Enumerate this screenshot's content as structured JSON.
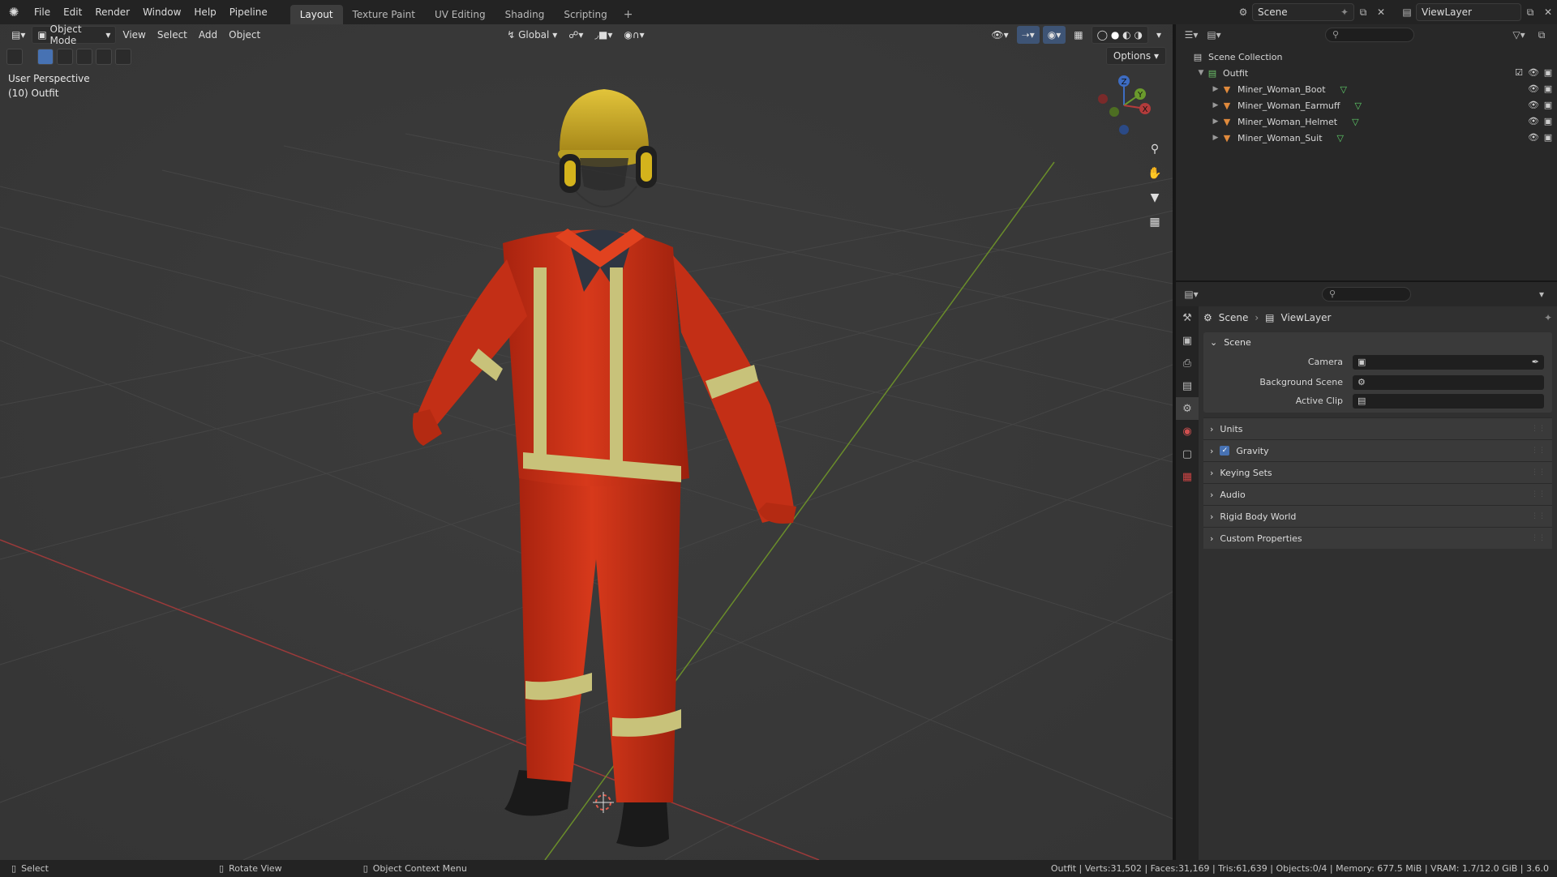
{
  "menu": [
    "File",
    "Edit",
    "Render",
    "Window",
    "Help",
    "Pipeline"
  ],
  "workspace_tabs": [
    "Layout",
    "Texture Paint",
    "UV Editing",
    "Shading",
    "Scripting"
  ],
  "active_tab": "Layout",
  "top_right": {
    "scene": "Scene",
    "view_layer": "ViewLayer"
  },
  "viewport": {
    "mode": "Object Mode",
    "menus": [
      "View",
      "Select",
      "Add",
      "Object"
    ],
    "orientation": "Global",
    "options_label": "Options",
    "info_line1": "User Perspective",
    "info_line2": "(10) Outfit",
    "gizmo_axes": {
      "z": "Z",
      "y": "Y",
      "x": "X"
    }
  },
  "outliner": {
    "root": "Scene Collection",
    "collection": "Outfit",
    "items": [
      "Miner_Woman_Boot",
      "Miner_Woman_Earmuff",
      "Miner_Woman_Helmet",
      "Miner_Woman_Suit"
    ]
  },
  "properties": {
    "crumb_scene": "Scene",
    "crumb_layer": "ViewLayer",
    "panel_title": "Scene",
    "fields": {
      "camera": "Camera",
      "background_scene": "Background Scene",
      "active_clip": "Active Clip"
    },
    "subpanels": [
      "Units",
      "Gravity",
      "Keying Sets",
      "Audio",
      "Rigid Body World",
      "Custom Properties"
    ]
  },
  "statusbar": {
    "left": [
      "Select",
      "Rotate View",
      "Object Context Menu"
    ],
    "stats": "Outfit | Verts:31,502 | Faces:31,169 | Tris:61,639 | Objects:0/4 | Memory: 677.5 MiB | VRAM: 1.7/12.0 GiB | 3.6.0"
  },
  "colors": {
    "accent": "#4772b3",
    "suit": "#d1341a",
    "helmet": "#d4b31c",
    "reflective": "#c8c27a",
    "axis_x": "#b33b3b",
    "axis_y": "#6a9a2c"
  }
}
